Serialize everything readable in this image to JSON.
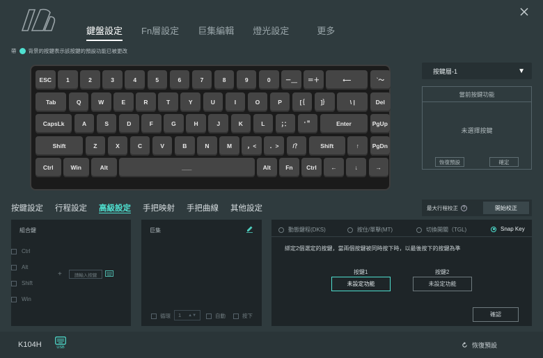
{
  "top_tabs": [
    {
      "label": "鍵盤設定"
    },
    {
      "label": "Fn層設定"
    },
    {
      "label": "巨集編輯"
    },
    {
      "label": "燈光設定"
    },
    {
      "label": "更多"
    }
  ],
  "legend": {
    "prefix": "帶",
    "text": "背景的按鍵表示該按鍵的預設功能已被更改"
  },
  "keyboard": {
    "rows": [
      [
        "ESC",
        "1",
        "2",
        "3",
        "4",
        "5",
        "6",
        "7",
        "8",
        "9",
        "0",
        "－＿",
        "＝＋",
        "⟵",
        "`～"
      ],
      [
        "Tab",
        "Q",
        "W",
        "E",
        "R",
        "T",
        "Y",
        "U",
        "I",
        "O",
        "P",
        "[｛",
        "]｝",
        "\\ |",
        "Del"
      ],
      [
        "CapsLk",
        "A",
        "S",
        "D",
        "F",
        "G",
        "H",
        "J",
        "K",
        "L",
        "；：",
        "'＂",
        "Enter",
        "PgUp"
      ],
      [
        "Shift",
        "Z",
        "X",
        "C",
        "V",
        "B",
        "N",
        "M",
        "，<",
        "．>",
        "/？",
        "Shift",
        "↑",
        "PgDn"
      ],
      [
        "Ctrl",
        "Win",
        "Alt",
        "___",
        "Alt",
        "Fn",
        "Ctrl",
        "←",
        "↓",
        "→"
      ]
    ]
  },
  "layer_select": {
    "value": "按鍵層-1"
  },
  "current_func": {
    "title": "當前按鍵功能",
    "empty": "未選擇按鍵",
    "restore_label": "恢復預設",
    "confirm_label": "確定"
  },
  "max_travel": {
    "label": "最大行程校正",
    "help": "?",
    "button": "開始校正"
  },
  "sub_tabs": [
    {
      "label": "按鍵設定"
    },
    {
      "label": "行程設定"
    },
    {
      "label": "高級設定"
    },
    {
      "label": "手把映射"
    },
    {
      "label": "手把曲線"
    },
    {
      "label": "其他設定"
    }
  ],
  "combo": {
    "title": "組合鍵",
    "modifiers": [
      "Ctrl",
      "Alt",
      "Shift",
      "Win"
    ],
    "plus": "+",
    "input_placeholder": "請輸入按鍵"
  },
  "macro": {
    "title": "巨集",
    "loop_label": "循環",
    "count": "1",
    "auto_label": "自動",
    "press_label": "按下"
  },
  "advanced": {
    "modes": [
      {
        "label": "動態鍵程(DKS)"
      },
      {
        "label": "按住/單擊(MT)"
      },
      {
        "label": "切換開關（TGL)"
      },
      {
        "label": "Snap Key"
      }
    ],
    "description": "綁定2個選定的按鍵，當兩個按鍵被同時按下時，以最後按下的按鍵為準",
    "key1_label": "按鍵1",
    "key2_label": "按鍵2",
    "key1_value": "未設定功能",
    "key2_value": "未設定功能",
    "confirm": "確認"
  },
  "footer": {
    "model": "K104H",
    "usb_label": "USB",
    "restore": "恢復預設"
  },
  "colors": {
    "accent": "#4fe0d0",
    "bg": "#2f3b3e",
    "panel": "#1e2528"
  }
}
